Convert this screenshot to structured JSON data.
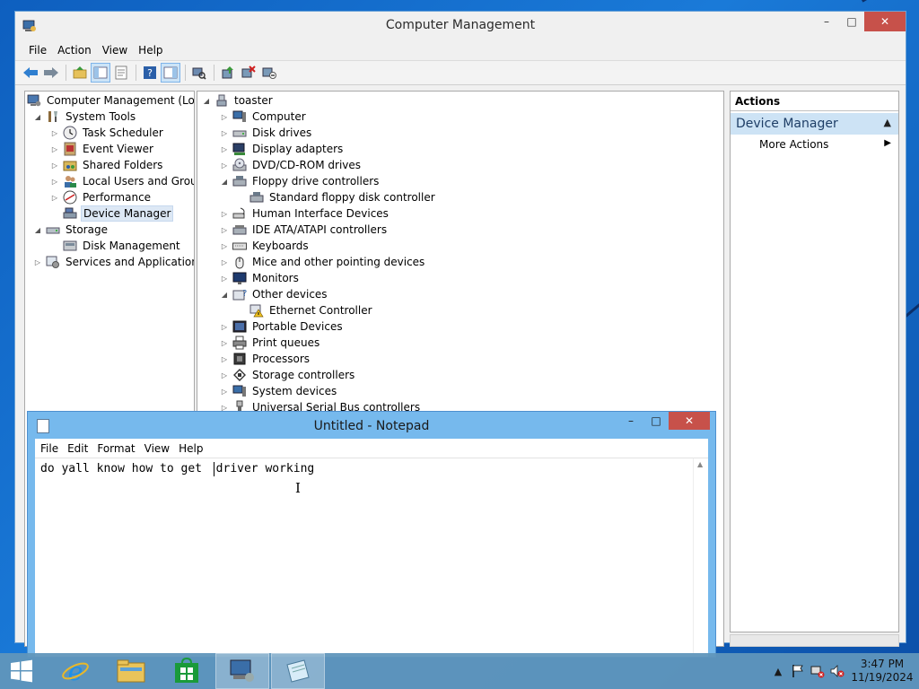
{
  "mmc": {
    "title": "Computer Management",
    "menu": [
      "File",
      "Action",
      "View",
      "Help"
    ],
    "toolbar_icons": [
      "back-arrow-icon",
      "forward-arrow-icon",
      "up-folder-icon",
      "show-hide-tree-icon",
      "properties-icon",
      "help-icon",
      "show-hide-action-pane-icon",
      "scan-hardware-icon",
      "update-driver-icon",
      "uninstall-device-icon",
      "disable-device-icon"
    ],
    "tree": [
      {
        "label": "Computer Management (Local",
        "level": 0,
        "expander": "",
        "icon": "computer-management-icon"
      },
      {
        "label": "System Tools",
        "level": 1,
        "expander": "expanded",
        "icon": "system-tools-icon"
      },
      {
        "label": "Task Scheduler",
        "level": 2,
        "expander": "collapsed",
        "icon": "clock-icon"
      },
      {
        "label": "Event Viewer",
        "level": 2,
        "expander": "collapsed",
        "icon": "event-viewer-icon"
      },
      {
        "label": "Shared Folders",
        "level": 2,
        "expander": "collapsed",
        "icon": "shared-folder-icon"
      },
      {
        "label": "Local Users and Groups",
        "level": 2,
        "expander": "collapsed",
        "icon": "users-icon"
      },
      {
        "label": "Performance",
        "level": 2,
        "expander": "collapsed",
        "icon": "performance-icon"
      },
      {
        "label": "Device Manager",
        "level": 2,
        "expander": "",
        "icon": "device-manager-icon",
        "selected": true
      },
      {
        "label": "Storage",
        "level": 1,
        "expander": "expanded",
        "icon": "storage-icon"
      },
      {
        "label": "Disk Management",
        "level": 2,
        "expander": "",
        "icon": "disk-management-icon"
      },
      {
        "label": "Services and Applications",
        "level": 1,
        "expander": "collapsed",
        "icon": "services-icon"
      }
    ],
    "devices": [
      {
        "label": "toaster",
        "level": 0,
        "expander": "expanded",
        "icon": "computer-root-icon"
      },
      {
        "label": "Computer",
        "level": 1,
        "expander": "collapsed",
        "icon": "computer-icon"
      },
      {
        "label": "Disk drives",
        "level": 1,
        "expander": "collapsed",
        "icon": "disk-drive-icon"
      },
      {
        "label": "Display adapters",
        "level": 1,
        "expander": "collapsed",
        "icon": "display-adapter-icon"
      },
      {
        "label": "DVD/CD-ROM drives",
        "level": 1,
        "expander": "collapsed",
        "icon": "dvd-drive-icon"
      },
      {
        "label": "Floppy drive controllers",
        "level": 1,
        "expander": "expanded",
        "icon": "floppy-controller-icon"
      },
      {
        "label": "Standard floppy disk controller",
        "level": 2,
        "expander": "",
        "icon": "floppy-controller-icon"
      },
      {
        "label": "Human Interface Devices",
        "level": 1,
        "expander": "collapsed",
        "icon": "hid-icon"
      },
      {
        "label": "IDE ATA/ATAPI controllers",
        "level": 1,
        "expander": "collapsed",
        "icon": "ide-controller-icon"
      },
      {
        "label": "Keyboards",
        "level": 1,
        "expander": "collapsed",
        "icon": "keyboard-icon"
      },
      {
        "label": "Mice and other pointing devices",
        "level": 1,
        "expander": "collapsed",
        "icon": "mouse-icon"
      },
      {
        "label": "Monitors",
        "level": 1,
        "expander": "collapsed",
        "icon": "monitor-icon"
      },
      {
        "label": "Other devices",
        "level": 1,
        "expander": "expanded",
        "icon": "unknown-device-icon"
      },
      {
        "label": "Ethernet Controller",
        "level": 2,
        "expander": "",
        "icon": "warning-device-icon"
      },
      {
        "label": "Portable Devices",
        "level": 1,
        "expander": "collapsed",
        "icon": "portable-device-icon"
      },
      {
        "label": "Print queues",
        "level": 1,
        "expander": "collapsed",
        "icon": "printer-icon"
      },
      {
        "label": "Processors",
        "level": 1,
        "expander": "collapsed",
        "icon": "processor-icon"
      },
      {
        "label": "Storage controllers",
        "level": 1,
        "expander": "collapsed",
        "icon": "storage-controller-icon"
      },
      {
        "label": "System devices",
        "level": 1,
        "expander": "collapsed",
        "icon": "system-device-icon"
      },
      {
        "label": "Universal Serial Bus controllers",
        "level": 1,
        "expander": "collapsed",
        "icon": "usb-icon"
      }
    ],
    "actions": {
      "header": "Actions",
      "section": "Device Manager",
      "items": [
        "More Actions"
      ]
    }
  },
  "notepad": {
    "title": "Untitled - Notepad",
    "menu": [
      "File",
      "Edit",
      "Format",
      "View",
      "Help"
    ],
    "text": "do yall know how to get  driver working"
  },
  "taskbar": {
    "apps": [
      {
        "name": "internet-explorer",
        "icon": "ie-icon"
      },
      {
        "name": "file-explorer",
        "icon": "folder-icon"
      },
      {
        "name": "store",
        "icon": "store-icon"
      },
      {
        "name": "computer-management",
        "icon": "computer-management-icon",
        "active": true
      },
      {
        "name": "notepad",
        "icon": "notepad-icon",
        "active": true
      }
    ],
    "time": "3:47 PM",
    "date": "11/19/2024"
  },
  "colors": {
    "accent": "#76b9ed",
    "close_button": "#c7514a",
    "selection": "#dde8f5",
    "actions_section": "#cde3f5"
  }
}
